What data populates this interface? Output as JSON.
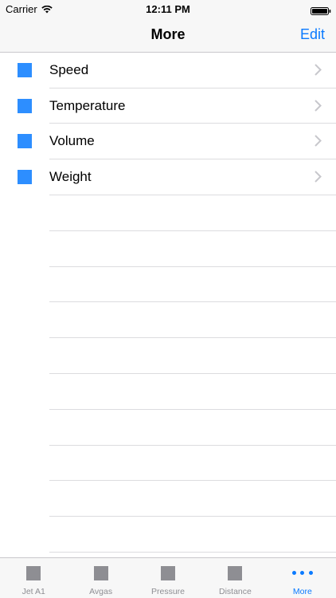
{
  "status_bar": {
    "carrier": "Carrier",
    "time": "12:11 PM"
  },
  "nav": {
    "title": "More",
    "edit_label": "Edit"
  },
  "list": {
    "items": [
      {
        "label": "Speed",
        "icon": "square-icon"
      },
      {
        "label": "Temperature",
        "icon": "square-icon"
      },
      {
        "label": "Volume",
        "icon": "square-icon"
      },
      {
        "label": "Weight",
        "icon": "square-icon"
      }
    ]
  },
  "tabs": [
    {
      "label": "Jet A1",
      "icon": "square-icon"
    },
    {
      "label": "Avgas",
      "icon": "square-icon"
    },
    {
      "label": "Pressure",
      "icon": "square-icon"
    },
    {
      "label": "Distance",
      "icon": "square-icon"
    },
    {
      "label": "More",
      "icon": "more-dots-icon",
      "active": true
    }
  ],
  "colors": {
    "accent": "#0a7aff",
    "list_icon": "#2d8eff",
    "tab_inactive": "#8e8e93"
  }
}
